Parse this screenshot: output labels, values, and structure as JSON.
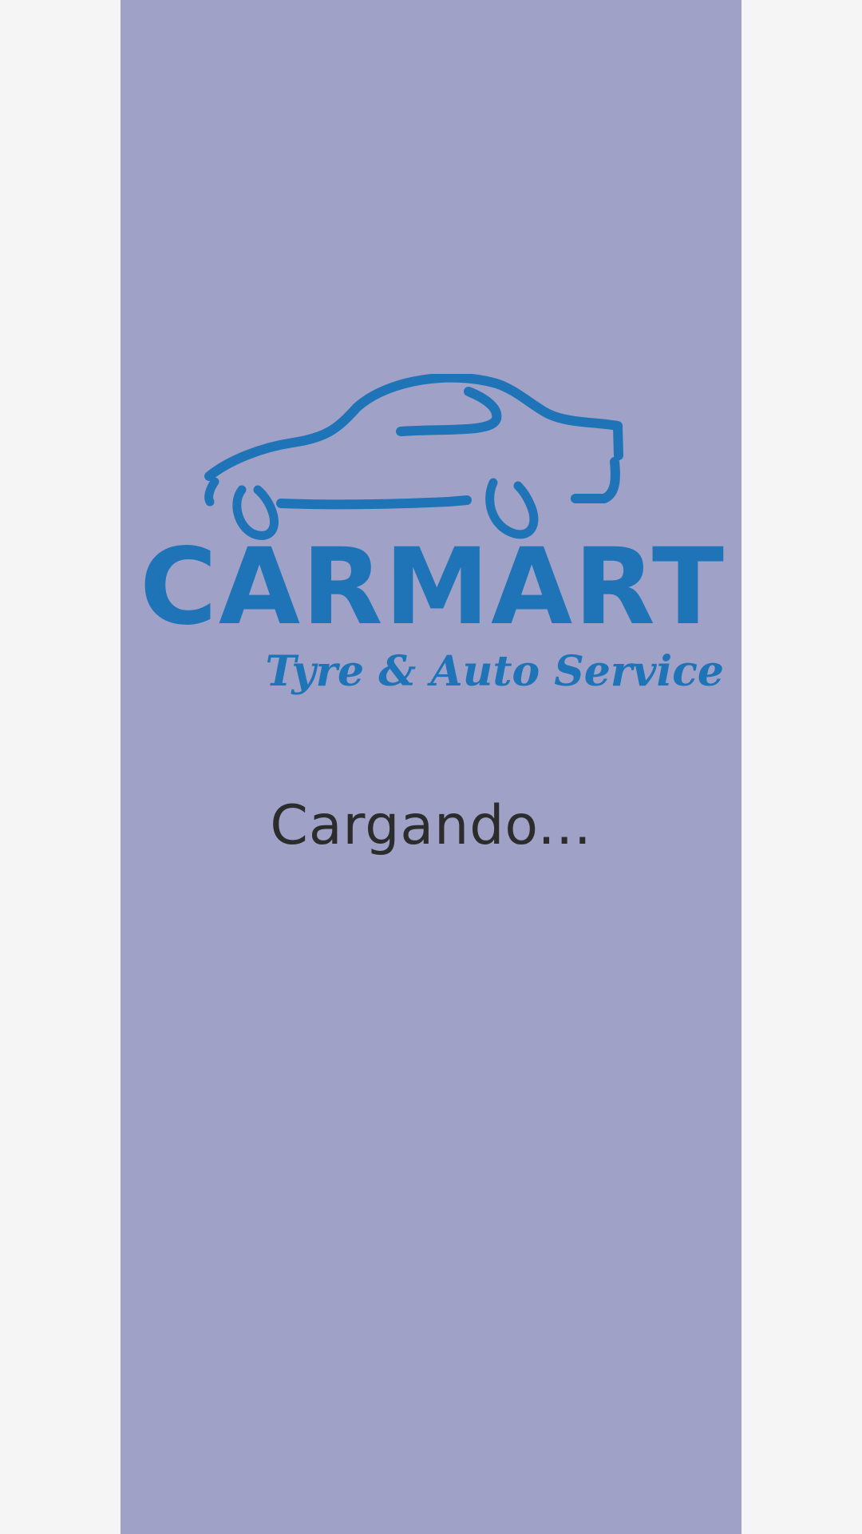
{
  "splash": {
    "background_color": "#9fa1c7",
    "page_background_color": "#f5f5f5",
    "logo": {
      "brand_name": "CARMART",
      "tagline": "Tyre & Auto Service",
      "color": "#1f73b7",
      "icon": "car-silhouette-icon"
    },
    "loading_text": "Cargando..."
  }
}
